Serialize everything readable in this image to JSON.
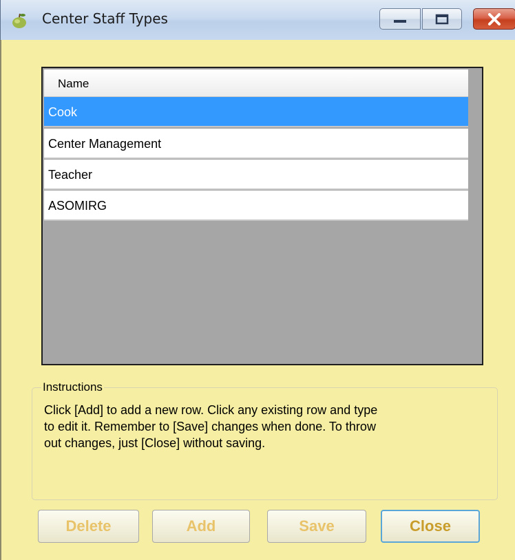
{
  "window": {
    "title": "Center Staff Types",
    "icon": "apple-icon"
  },
  "grid": {
    "column_header": "Name",
    "rows": [
      {
        "name": "Cook",
        "selected": true
      },
      {
        "name": "Center Management",
        "selected": false
      },
      {
        "name": "Teacher",
        "selected": false
      },
      {
        "name": "ASOMIRG",
        "selected": false
      }
    ]
  },
  "instructions": {
    "legend": "Instructions",
    "lines": [
      "Click [Add] to add a new row.  Click any existing row and type",
      "to edit it.  Remember to [Save] changes when done.  To throw",
      "out changes, just [Close] without saving."
    ]
  },
  "buttons": {
    "delete_label": "Delete",
    "add_label": "Add",
    "save_label": "Save",
    "close_label": "Close"
  },
  "colors": {
    "client_background": "#f6efa3",
    "selection": "#3399ff",
    "button_text": "#e8c36a"
  }
}
